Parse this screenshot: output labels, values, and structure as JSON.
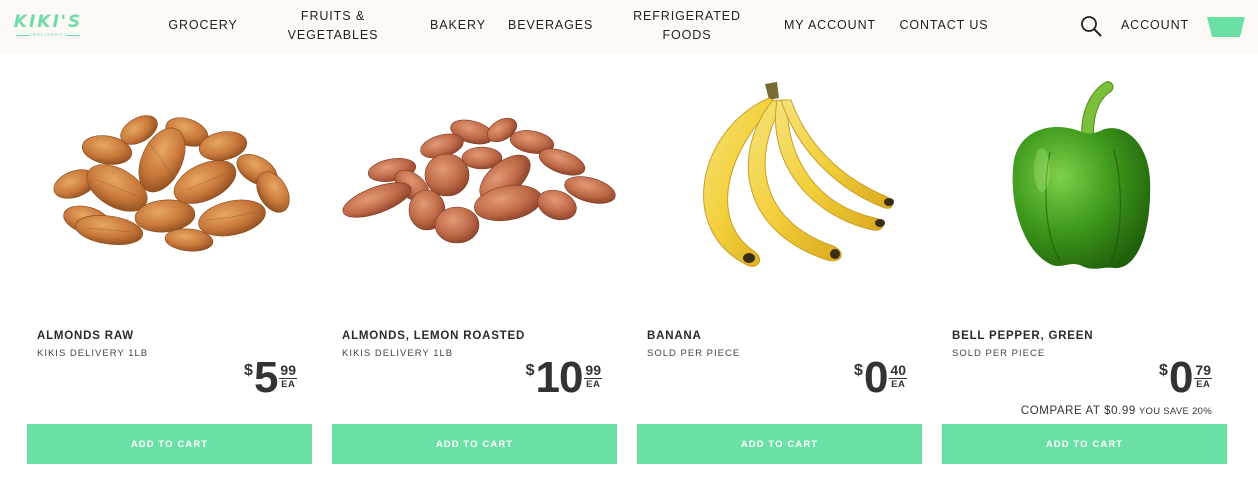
{
  "brand": {
    "logo_text": "KIKI'S",
    "logo_sub": "DELIVERY",
    "color": "#6fdba8"
  },
  "nav": {
    "items": [
      "GROCERY",
      "FRUITS & VEGETABLES",
      "BAKERY",
      "BEVERAGES",
      "REFRIGERATED FOODS",
      "MY ACCOUNT",
      "CONTACT US"
    ],
    "account_label": "ACCOUNT",
    "search_icon": "search-icon",
    "cart_icon": "cart-icon"
  },
  "products": [
    {
      "name": "ALMONDS RAW",
      "subtitle": "KIKIS DELIVERY 1LB",
      "currency": "$",
      "dollars": "5",
      "cents": "99",
      "unit": "EA",
      "button": "ADD TO CART",
      "image": "almonds-raw"
    },
    {
      "name": "ALMONDS, LEMON ROASTED",
      "subtitle": "KIKIS DELIVERY 1LB",
      "currency": "$",
      "dollars": "10",
      "cents": "99",
      "unit": "EA",
      "button": "ADD TO CART",
      "image": "almonds-roasted"
    },
    {
      "name": "BANANA",
      "subtitle": "SOLD PER PIECE",
      "currency": "$",
      "dollars": "0",
      "cents": "40",
      "unit": "EA",
      "button": "ADD TO CART",
      "image": "banana"
    },
    {
      "name": "BELL PEPPER, GREEN",
      "subtitle": "SOLD PER PIECE",
      "currency": "$",
      "dollars": "0",
      "cents": "79",
      "unit": "EA",
      "compare": "COMPARE AT $0.99",
      "save": "YOU SAVE 20%",
      "button": "ADD TO CART",
      "image": "green-bell-pepper"
    }
  ],
  "colors": {
    "accent": "#6be0a5",
    "header_bg": "#fdfaf5",
    "text": "#333333"
  }
}
